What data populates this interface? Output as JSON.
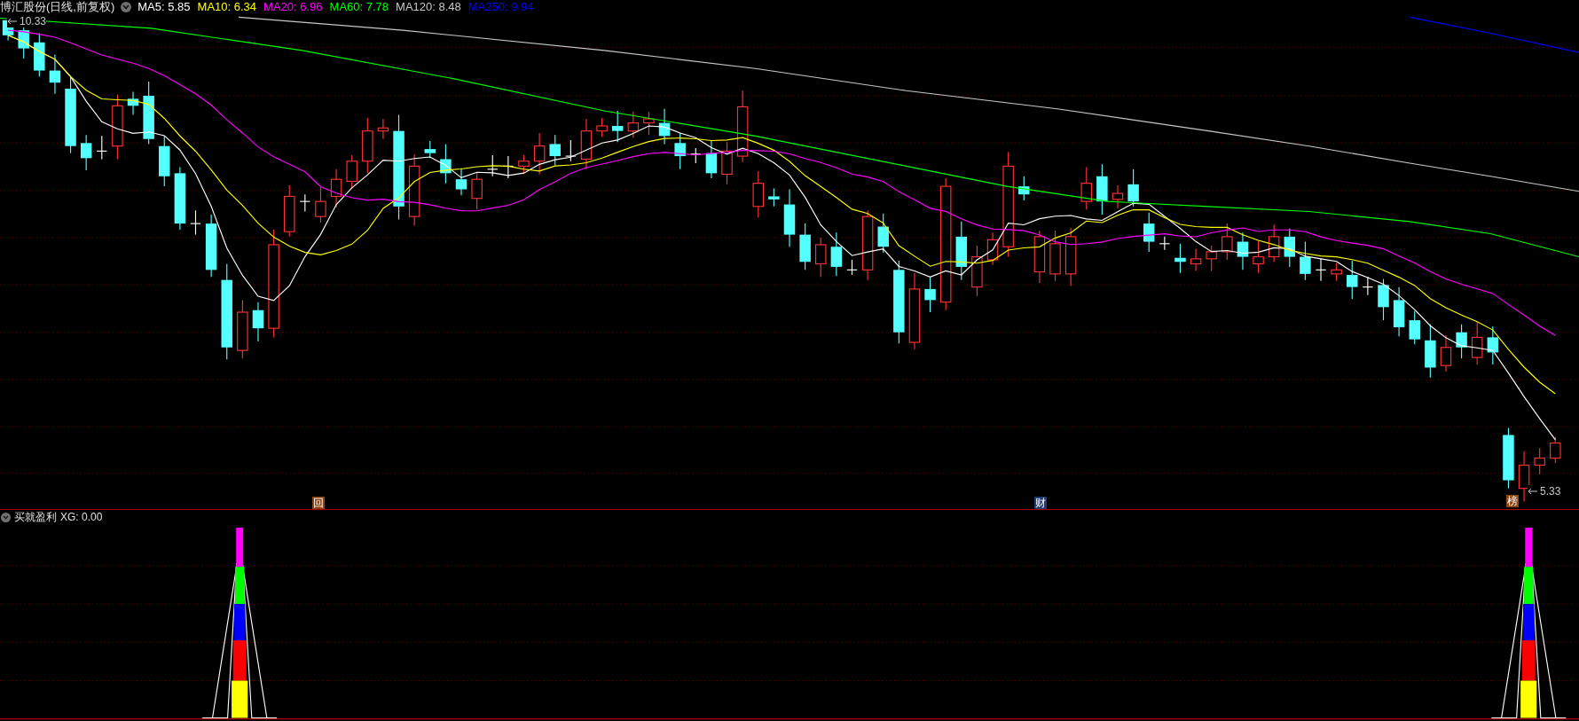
{
  "title": {
    "stock": "博汇股份(日线,前复权)"
  },
  "ma_legend": [
    {
      "label": "MA5: 5.85",
      "color": "#ffffff"
    },
    {
      "label": "MA10: 6.34",
      "color": "#ffff00"
    },
    {
      "label": "MA20: 6.96",
      "color": "#ff00ff"
    },
    {
      "label": "MA60: 7.78",
      "color": "#00ff00"
    },
    {
      "label": "MA120: 8.48",
      "color": "#c8c8c8"
    },
    {
      "label": "MA250: 9.94",
      "color": "#0000ff"
    }
  ],
  "price_markers": [
    {
      "kind": "high",
      "label": "10.33"
    },
    {
      "kind": "low",
      "label": "5.33"
    }
  ],
  "event_badges": [
    {
      "label": "回",
      "color": "#8b4513"
    },
    {
      "label": "财",
      "color": "#1e3a6e"
    },
    {
      "label": "榜",
      "color": "#8b4513"
    }
  ],
  "indicator": {
    "title": "买就盈利",
    "reading": "XG: 0.00"
  }
}
